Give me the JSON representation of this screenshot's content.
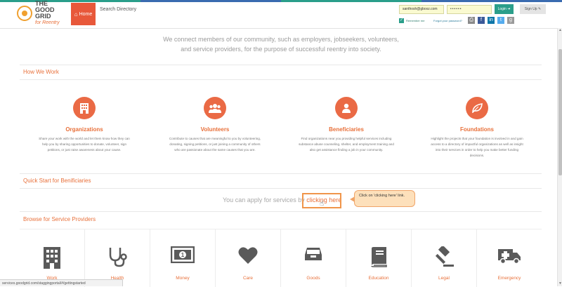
{
  "header": {
    "logo_line1": "THE",
    "logo_line2": "GOOD",
    "logo_line3": "GRID",
    "logo_tagline": "for Reentry",
    "home_label": "Home",
    "search_directory": "Search Directory",
    "login_email": "santhosh@gboxz.com",
    "login_password": "••••••",
    "login_button": "Login",
    "signup_button": "Sign Up",
    "remember_me": "Remember me",
    "forgot_password": "Forgot your password?",
    "social": [
      "f",
      "in",
      "t",
      "g"
    ]
  },
  "mission": "We connect members of our community, such as employers, jobseekers, volunteers, and service providers, for the purpose of successful reentry into society.",
  "how_we_work": {
    "title": "How We Work",
    "cards": [
      {
        "title": "Organizations",
        "desc": "Share your work with the world and let them know how they can help you by sharing opportunities to donate, volunteer, sign petitions, or just raise awareness about your cause.",
        "icon": "building-icon"
      },
      {
        "title": "Volunteers",
        "desc": "Contribute to causes that are meaningful to you by volunteering, donating, signing petitions, or just joining a community of others who are passionate about the same causes that you are.",
        "icon": "group-icon"
      },
      {
        "title": "Beneficiaries",
        "desc": "Find organizations near you providing helpful services including substance abuse counseling, shelter, and employment training and also get assistance finding a job in your community.",
        "icon": "person-icon"
      },
      {
        "title": "Foundations",
        "desc": "Highlight the projects that your foundation is involved in and gain access to a directory of impactful organizations as well as insight into their services in order to help you make better funding decisions.",
        "icon": "leaf-icon"
      }
    ]
  },
  "quick_start": {
    "title": "Quick Start for Benificiaries",
    "apply_text": "You can apply for services by",
    "apply_link": "clicking here",
    "callout": "Click on 'clicking here' link."
  },
  "browse": {
    "title": "Browse for Service Providers",
    "providers": [
      "Work",
      "Health",
      "Money",
      "Care",
      "Goods",
      "Education",
      "Legal",
      "Emergency"
    ]
  },
  "statusbar": "services.goodgrid.com/staggingportal/#/gettingstarted",
  "colors": {
    "accent": "#e8703a",
    "teal": "#2a9e8a",
    "home": "#e8583a"
  }
}
